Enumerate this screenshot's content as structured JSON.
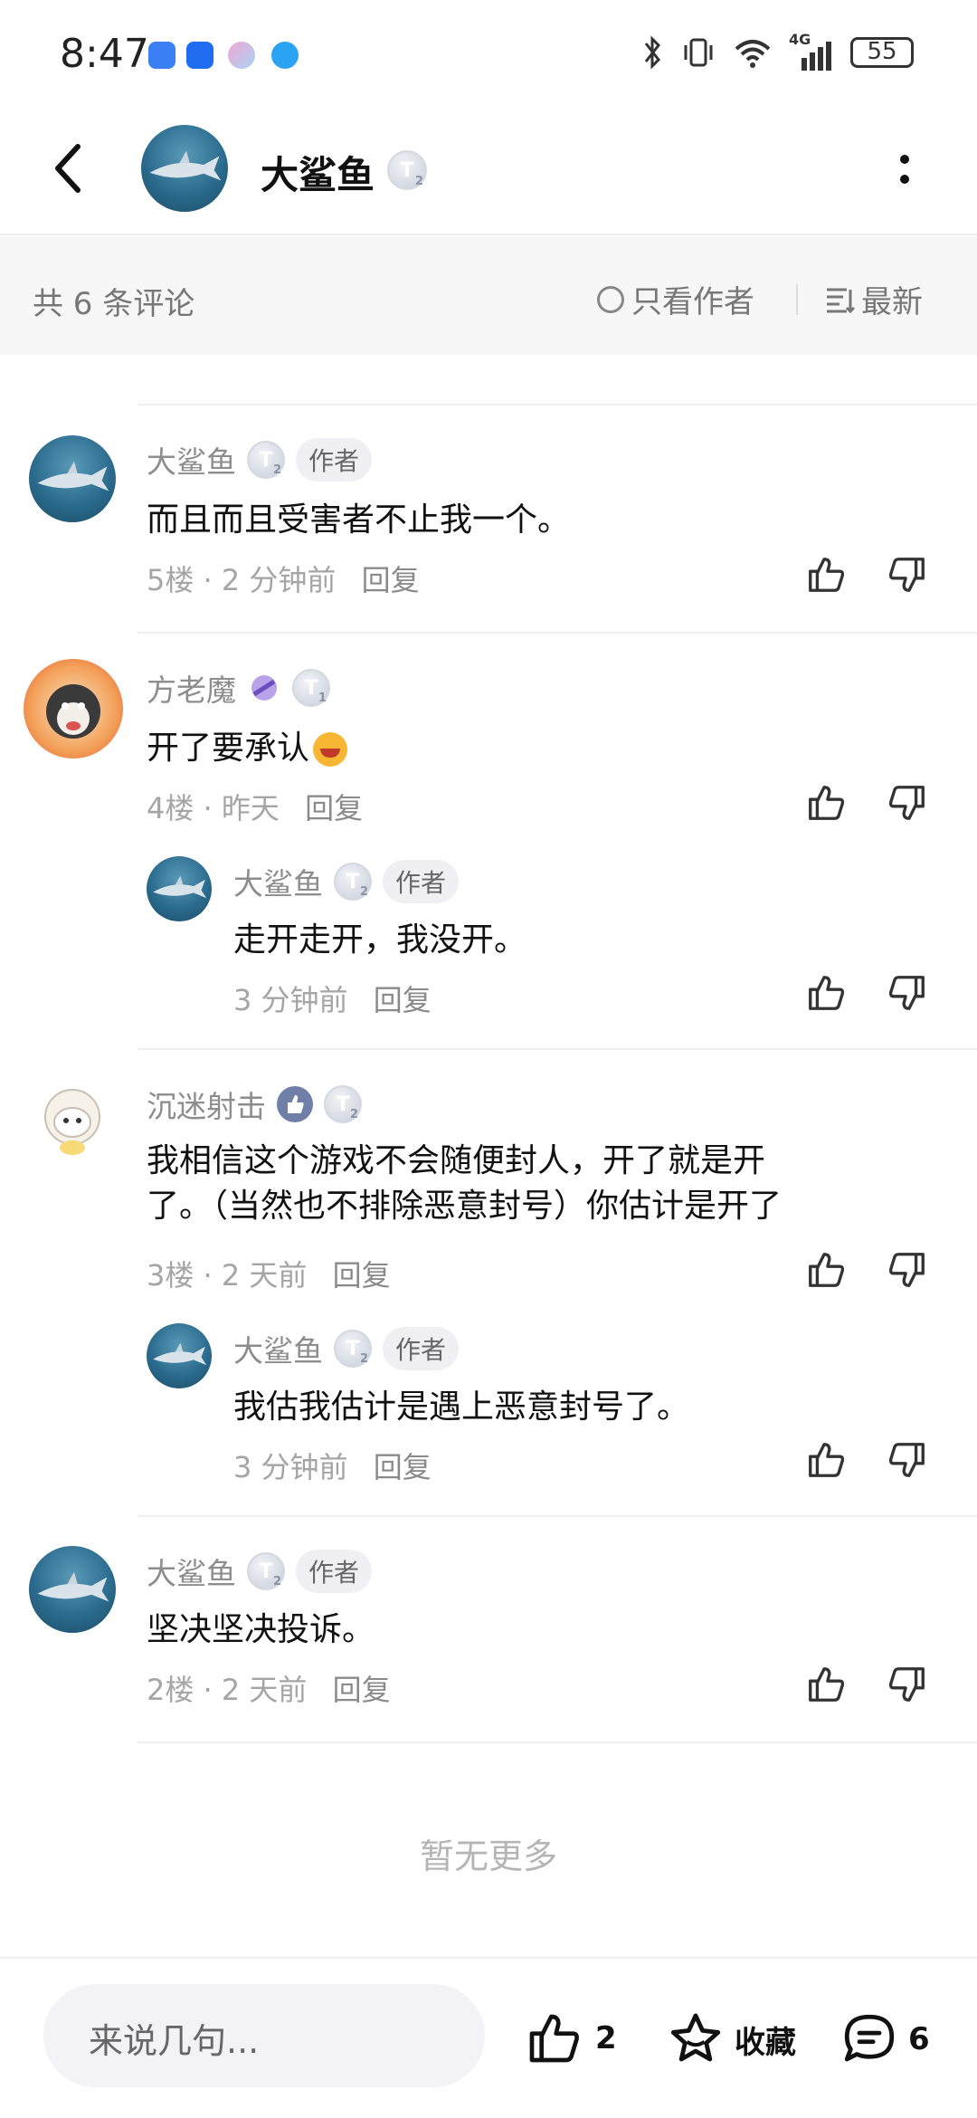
{
  "status_bar": {
    "time": "8:47",
    "network": "4G",
    "battery": "55",
    "app_colors": [
      "#3b7ff5",
      "#1e6cf0",
      "#f2a7d6",
      "#2aa3f3"
    ]
  },
  "header": {
    "title": "大鲨鱼",
    "level_badge": "T",
    "level_sub": "2"
  },
  "sortbar": {
    "count_label": "共 6 条评论",
    "only_author_label": "只看作者",
    "sort_label": "最新"
  },
  "comments": [
    {
      "name": "大鲨鱼",
      "badge": "T",
      "badge_sub": "2",
      "author_tag": "作者",
      "text": "而且而且受害者不止我一个。",
      "floor": "5楼",
      "time": "2 分钟前",
      "reply": "回复"
    },
    {
      "name": "方老魔",
      "badge": "T",
      "badge_sub": "1",
      "text": "开了要承认",
      "floor": "4楼",
      "time": "昨天",
      "reply": "回复",
      "sub": {
        "name": "大鲨鱼",
        "badge": "T",
        "badge_sub": "2",
        "author_tag": "作者",
        "text": "走开走开，我没开。",
        "time": "3 分钟前",
        "reply": "回复"
      }
    },
    {
      "name": "沉迷射击",
      "badge": "T",
      "badge_sub": "2",
      "text_line1": "我相信这个游戏不会随便封人，开了就是开",
      "text_line2": "了。（当然也不排除恶意封号）你估计是开了",
      "floor": "3楼",
      "time": "2 天前",
      "reply": "回复",
      "sub": {
        "name": "大鲨鱼",
        "badge": "T",
        "badge_sub": "2",
        "author_tag": "作者",
        "text": "我估我估计是遇上恶意封号了。",
        "time": "3 分钟前",
        "reply": "回复"
      }
    },
    {
      "name": "大鲨鱼",
      "badge": "T",
      "badge_sub": "2",
      "author_tag": "作者",
      "text": "坚决坚决投诉。",
      "floor": "2楼",
      "time": "2 天前",
      "reply": "回复"
    }
  ],
  "no_more": "暂无更多",
  "bottom_bar": {
    "input_placeholder": "来说几句...",
    "like_count": "2",
    "favorite_label": "收藏",
    "comment_count": "6"
  }
}
